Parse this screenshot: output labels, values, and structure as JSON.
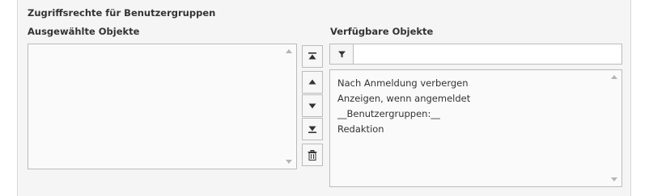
{
  "section": {
    "title": "Zugriffsrechte für Benutzergruppen"
  },
  "selected": {
    "label": "Ausgewählte Objekte",
    "items": []
  },
  "available": {
    "label": "Verfügbare Objekte",
    "filter_value": "",
    "items": [
      "Nach Anmeldung verbergen",
      "Anzeigen, wenn angemeldet",
      "__Benutzergruppen:__",
      "Redaktion"
    ]
  },
  "buttons": {
    "move_top_icon": "move-to-top-icon",
    "move_up_icon": "move-up-icon",
    "move_down_icon": "move-down-icon",
    "move_bottom_icon": "move-to-bottom-icon",
    "delete_icon": "trash-icon"
  },
  "colors": {
    "panel_bg": "#f5f5f5",
    "border": "#bbbbbb",
    "text": "#333333"
  }
}
